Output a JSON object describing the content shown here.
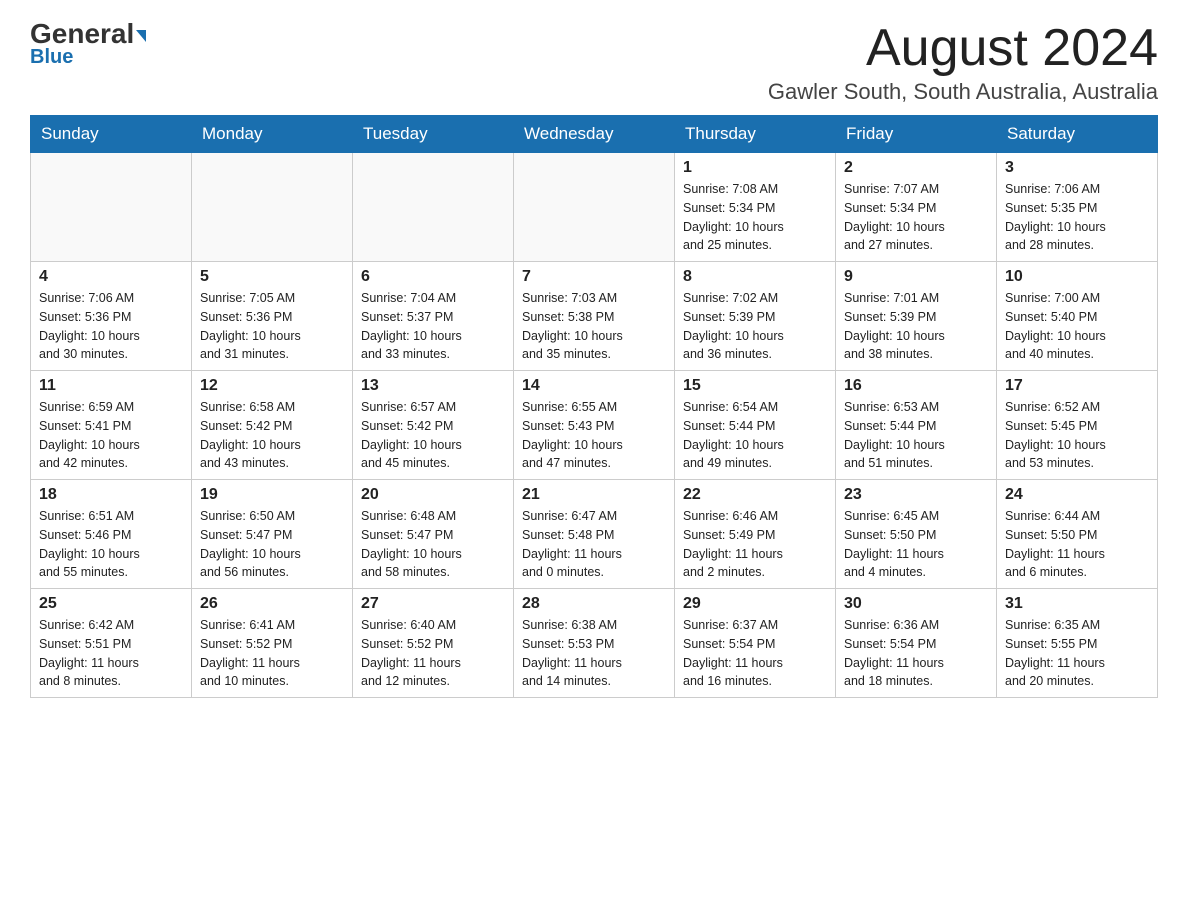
{
  "header": {
    "logo_main": "General",
    "logo_sub": "Blue",
    "title": "August 2024",
    "subtitle": "Gawler South, South Australia, Australia"
  },
  "weekdays": [
    "Sunday",
    "Monday",
    "Tuesday",
    "Wednesday",
    "Thursday",
    "Friday",
    "Saturday"
  ],
  "weeks": [
    [
      {
        "day": "",
        "info": ""
      },
      {
        "day": "",
        "info": ""
      },
      {
        "day": "",
        "info": ""
      },
      {
        "day": "",
        "info": ""
      },
      {
        "day": "1",
        "info": "Sunrise: 7:08 AM\nSunset: 5:34 PM\nDaylight: 10 hours\nand 25 minutes."
      },
      {
        "day": "2",
        "info": "Sunrise: 7:07 AM\nSunset: 5:34 PM\nDaylight: 10 hours\nand 27 minutes."
      },
      {
        "day": "3",
        "info": "Sunrise: 7:06 AM\nSunset: 5:35 PM\nDaylight: 10 hours\nand 28 minutes."
      }
    ],
    [
      {
        "day": "4",
        "info": "Sunrise: 7:06 AM\nSunset: 5:36 PM\nDaylight: 10 hours\nand 30 minutes."
      },
      {
        "day": "5",
        "info": "Sunrise: 7:05 AM\nSunset: 5:36 PM\nDaylight: 10 hours\nand 31 minutes."
      },
      {
        "day": "6",
        "info": "Sunrise: 7:04 AM\nSunset: 5:37 PM\nDaylight: 10 hours\nand 33 minutes."
      },
      {
        "day": "7",
        "info": "Sunrise: 7:03 AM\nSunset: 5:38 PM\nDaylight: 10 hours\nand 35 minutes."
      },
      {
        "day": "8",
        "info": "Sunrise: 7:02 AM\nSunset: 5:39 PM\nDaylight: 10 hours\nand 36 minutes."
      },
      {
        "day": "9",
        "info": "Sunrise: 7:01 AM\nSunset: 5:39 PM\nDaylight: 10 hours\nand 38 minutes."
      },
      {
        "day": "10",
        "info": "Sunrise: 7:00 AM\nSunset: 5:40 PM\nDaylight: 10 hours\nand 40 minutes."
      }
    ],
    [
      {
        "day": "11",
        "info": "Sunrise: 6:59 AM\nSunset: 5:41 PM\nDaylight: 10 hours\nand 42 minutes."
      },
      {
        "day": "12",
        "info": "Sunrise: 6:58 AM\nSunset: 5:42 PM\nDaylight: 10 hours\nand 43 minutes."
      },
      {
        "day": "13",
        "info": "Sunrise: 6:57 AM\nSunset: 5:42 PM\nDaylight: 10 hours\nand 45 minutes."
      },
      {
        "day": "14",
        "info": "Sunrise: 6:55 AM\nSunset: 5:43 PM\nDaylight: 10 hours\nand 47 minutes."
      },
      {
        "day": "15",
        "info": "Sunrise: 6:54 AM\nSunset: 5:44 PM\nDaylight: 10 hours\nand 49 minutes."
      },
      {
        "day": "16",
        "info": "Sunrise: 6:53 AM\nSunset: 5:44 PM\nDaylight: 10 hours\nand 51 minutes."
      },
      {
        "day": "17",
        "info": "Sunrise: 6:52 AM\nSunset: 5:45 PM\nDaylight: 10 hours\nand 53 minutes."
      }
    ],
    [
      {
        "day": "18",
        "info": "Sunrise: 6:51 AM\nSunset: 5:46 PM\nDaylight: 10 hours\nand 55 minutes."
      },
      {
        "day": "19",
        "info": "Sunrise: 6:50 AM\nSunset: 5:47 PM\nDaylight: 10 hours\nand 56 minutes."
      },
      {
        "day": "20",
        "info": "Sunrise: 6:48 AM\nSunset: 5:47 PM\nDaylight: 10 hours\nand 58 minutes."
      },
      {
        "day": "21",
        "info": "Sunrise: 6:47 AM\nSunset: 5:48 PM\nDaylight: 11 hours\nand 0 minutes."
      },
      {
        "day": "22",
        "info": "Sunrise: 6:46 AM\nSunset: 5:49 PM\nDaylight: 11 hours\nand 2 minutes."
      },
      {
        "day": "23",
        "info": "Sunrise: 6:45 AM\nSunset: 5:50 PM\nDaylight: 11 hours\nand 4 minutes."
      },
      {
        "day": "24",
        "info": "Sunrise: 6:44 AM\nSunset: 5:50 PM\nDaylight: 11 hours\nand 6 minutes."
      }
    ],
    [
      {
        "day": "25",
        "info": "Sunrise: 6:42 AM\nSunset: 5:51 PM\nDaylight: 11 hours\nand 8 minutes."
      },
      {
        "day": "26",
        "info": "Sunrise: 6:41 AM\nSunset: 5:52 PM\nDaylight: 11 hours\nand 10 minutes."
      },
      {
        "day": "27",
        "info": "Sunrise: 6:40 AM\nSunset: 5:52 PM\nDaylight: 11 hours\nand 12 minutes."
      },
      {
        "day": "28",
        "info": "Sunrise: 6:38 AM\nSunset: 5:53 PM\nDaylight: 11 hours\nand 14 minutes."
      },
      {
        "day": "29",
        "info": "Sunrise: 6:37 AM\nSunset: 5:54 PM\nDaylight: 11 hours\nand 16 minutes."
      },
      {
        "day": "30",
        "info": "Sunrise: 6:36 AM\nSunset: 5:54 PM\nDaylight: 11 hours\nand 18 minutes."
      },
      {
        "day": "31",
        "info": "Sunrise: 6:35 AM\nSunset: 5:55 PM\nDaylight: 11 hours\nand 20 minutes."
      }
    ]
  ]
}
